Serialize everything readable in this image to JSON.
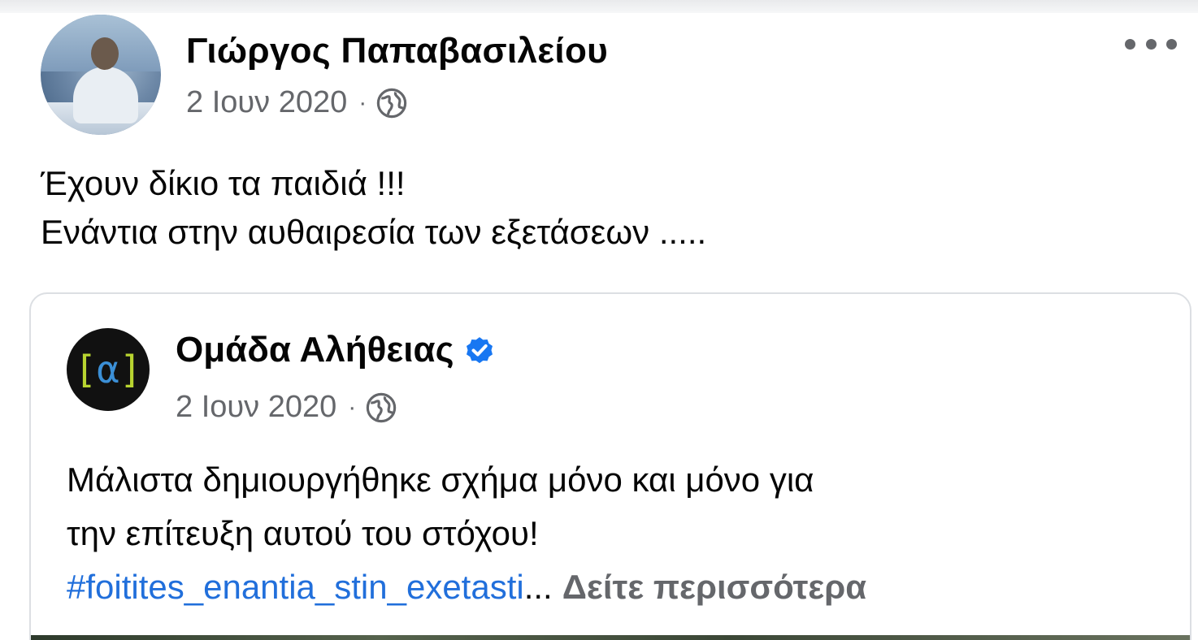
{
  "post": {
    "author_name": "Γιώργος Παπαβασιλείου",
    "date": "2 Ιουν 2020",
    "separator": "·",
    "audience_icon": "globe-icon",
    "more_icon": "more-options-icon",
    "text_lines": [
      "Έχουν δίκιο τα παιδιά !!!",
      "Ενάντια στην αυθαιρεσία των εξετάσεων ....."
    ]
  },
  "shared": {
    "page_name": "Ομάδα Αλήθειας",
    "verified_icon": "verified-badge-icon",
    "date": "2 Ιουν 2020",
    "separator": "·",
    "audience_icon": "globe-icon",
    "logo_left_bracket": "[",
    "logo_letter": "α",
    "logo_right_bracket": "]",
    "text_lines": [
      "Μάλιστα δημιουργήθηκε σχήμα μόνο και μόνο για",
      "την επίτευξη αυτού του στόχου!"
    ],
    "hashtag": "#foitites_enantia_stin_exetasti",
    "ellipsis": "...",
    "see_more": "Δείτε περισσότερα"
  },
  "colors": {
    "hashtag": "#216fdb",
    "secondary_text": "#65676b",
    "verified": "#1877f2",
    "logo_bracket": "#b8d430",
    "logo_letter": "#3b8fd6"
  }
}
